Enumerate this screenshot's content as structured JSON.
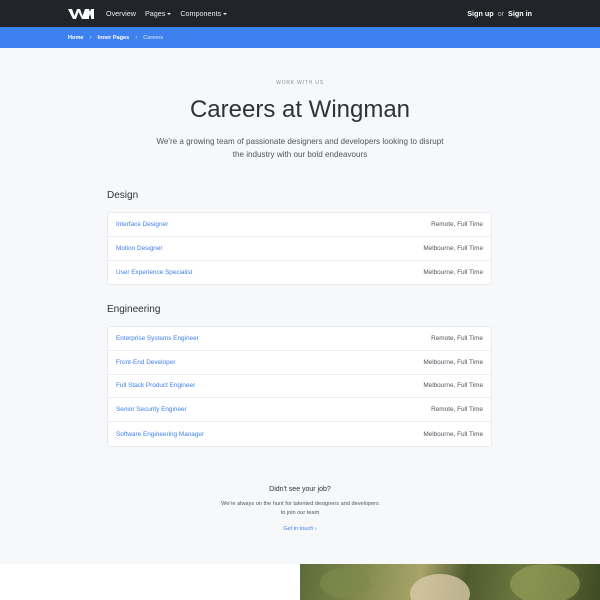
{
  "nav": {
    "items": [
      {
        "label": "Overview",
        "dropdown": false
      },
      {
        "label": "Pages",
        "dropdown": true
      },
      {
        "label": "Components",
        "dropdown": true
      }
    ],
    "signup": "Sign up",
    "or": "or",
    "signin": "Sign in"
  },
  "breadcrumb": {
    "home": "Home",
    "inner": "Inner Pages",
    "current": "Careers",
    "separator": "›"
  },
  "hero": {
    "eyebrow": "WORK WITH US",
    "title": "Careers at Wingman",
    "lead": "We're a growing team of passionate designers and developers looking to disrupt the industry with our bold endeavours"
  },
  "sections": [
    {
      "title": "Design",
      "jobs": [
        {
          "title": "Interface Designer",
          "meta": "Remote, Full Time"
        },
        {
          "title": "Motion Designer",
          "meta": "Melbourne, Full Time"
        },
        {
          "title": "User Experience Specialist",
          "meta": "Melbourne, Full Time"
        }
      ]
    },
    {
      "title": "Engineering",
      "jobs": [
        {
          "title": "Enterprise Systems Engineer",
          "meta": "Remote, Full Time"
        },
        {
          "title": "Front-End Developer",
          "meta": "Melbourne, Full Time"
        },
        {
          "title": "Full Stack Product Engineer",
          "meta": "Melbourne, Full Time"
        },
        {
          "title": "Senior Security Engineer",
          "meta": "Remote, Full Time"
        },
        {
          "title": "Software Engineering Manager",
          "meta": "Melbourne, Full Time"
        }
      ]
    }
  ],
  "cta": {
    "question": "Didn't see your job?",
    "text": "We're always on the hunt for talented designers and developers to join our team",
    "link": "Get in touch ›"
  },
  "colors": {
    "navbar": "#212529",
    "accent": "#3d80ee",
    "background": "#f7f8fa"
  },
  "icons": {
    "logo": "wingman-logo",
    "dropdown": "caret-down-icon",
    "breadcrumb_separator": "chevron-right-icon"
  }
}
